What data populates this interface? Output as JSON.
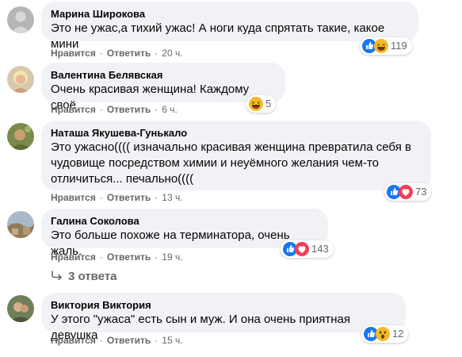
{
  "comments": [
    {
      "author": "Марина Широкова",
      "text": "Это не ужас,а тихий ужас! А ноги куда спрятать такие, какое мини",
      "like": "Нравится",
      "reply": "Ответить",
      "time": "20 ч.",
      "reaction_count": "119",
      "reactions": [
        "like-icon",
        "haha-icon"
      ]
    },
    {
      "author": "Валентина Белявская",
      "text": "Очень красивая женщина! Каждому своё",
      "like": "Нравится",
      "reply": "Ответить",
      "time": "6 ч.",
      "reaction_count": "5",
      "reactions": [
        "haha-icon"
      ]
    },
    {
      "author": "Наташа Якушева-Гунькало",
      "text": "Это ужасно(((( изначально красивая женщина превратила себя в чудовище посредством химии и неуёмного желания чем-то отличиться... печально((((",
      "like": "Нравится",
      "reply": "Ответить",
      "time": "13 ч.",
      "reaction_count": "73",
      "reactions": [
        "like-icon",
        "love-icon"
      ]
    },
    {
      "author": "Галина Соколова",
      "text": "Это больше похоже на терминатора, очень жаль.",
      "like": "Нравится",
      "reply": "Ответить",
      "time": "19 ч.",
      "reaction_count": "143",
      "reactions": [
        "like-icon",
        "love-icon"
      ]
    },
    {
      "author": "Виктория Виктория",
      "text": "У этого \"ужаса\" есть сын и муж. И она очень приятная девушка",
      "like": "Нравится",
      "reply": "Ответить",
      "time": "15 ч.",
      "reaction_count": "12",
      "reactions": [
        "like-icon",
        "wow-icon"
      ]
    }
  ],
  "replies_link": "3 ответа",
  "separator": "·",
  "colors": {
    "bubble": "#f0f2f5",
    "meta": "#65676b",
    "like": "#1877f2",
    "love": "#f33e58",
    "haha": "#f7b928"
  }
}
